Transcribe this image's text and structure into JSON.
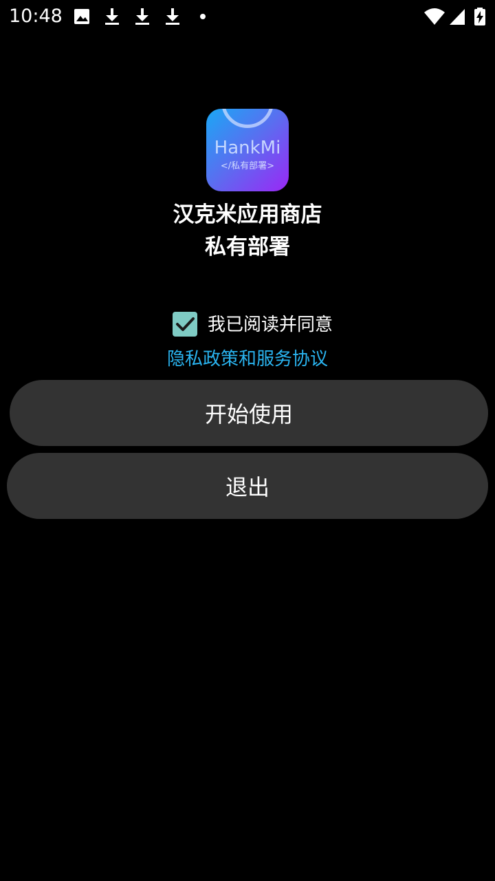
{
  "status_bar": {
    "time": "10:48",
    "icons": [
      "image-icon",
      "download-icon",
      "download-icon",
      "download-icon",
      "dot-icon",
      "wifi-icon",
      "signal-icon",
      "battery-charging-icon"
    ]
  },
  "app": {
    "icon_brand": "HankMi",
    "icon_tag": "</私有部署>",
    "title_line1": "汉克米应用商店",
    "title_line2": "私有部署"
  },
  "agreement": {
    "checked": true,
    "label": "我已阅读并同意",
    "link_text": "隐私政策和服务协议"
  },
  "buttons": {
    "start_label": "开始使用",
    "exit_label": "退出"
  },
  "colors": {
    "background": "#000000",
    "button_bg": "#333333",
    "link": "#2ab4f0",
    "checkbox": "#7fcbc4"
  }
}
